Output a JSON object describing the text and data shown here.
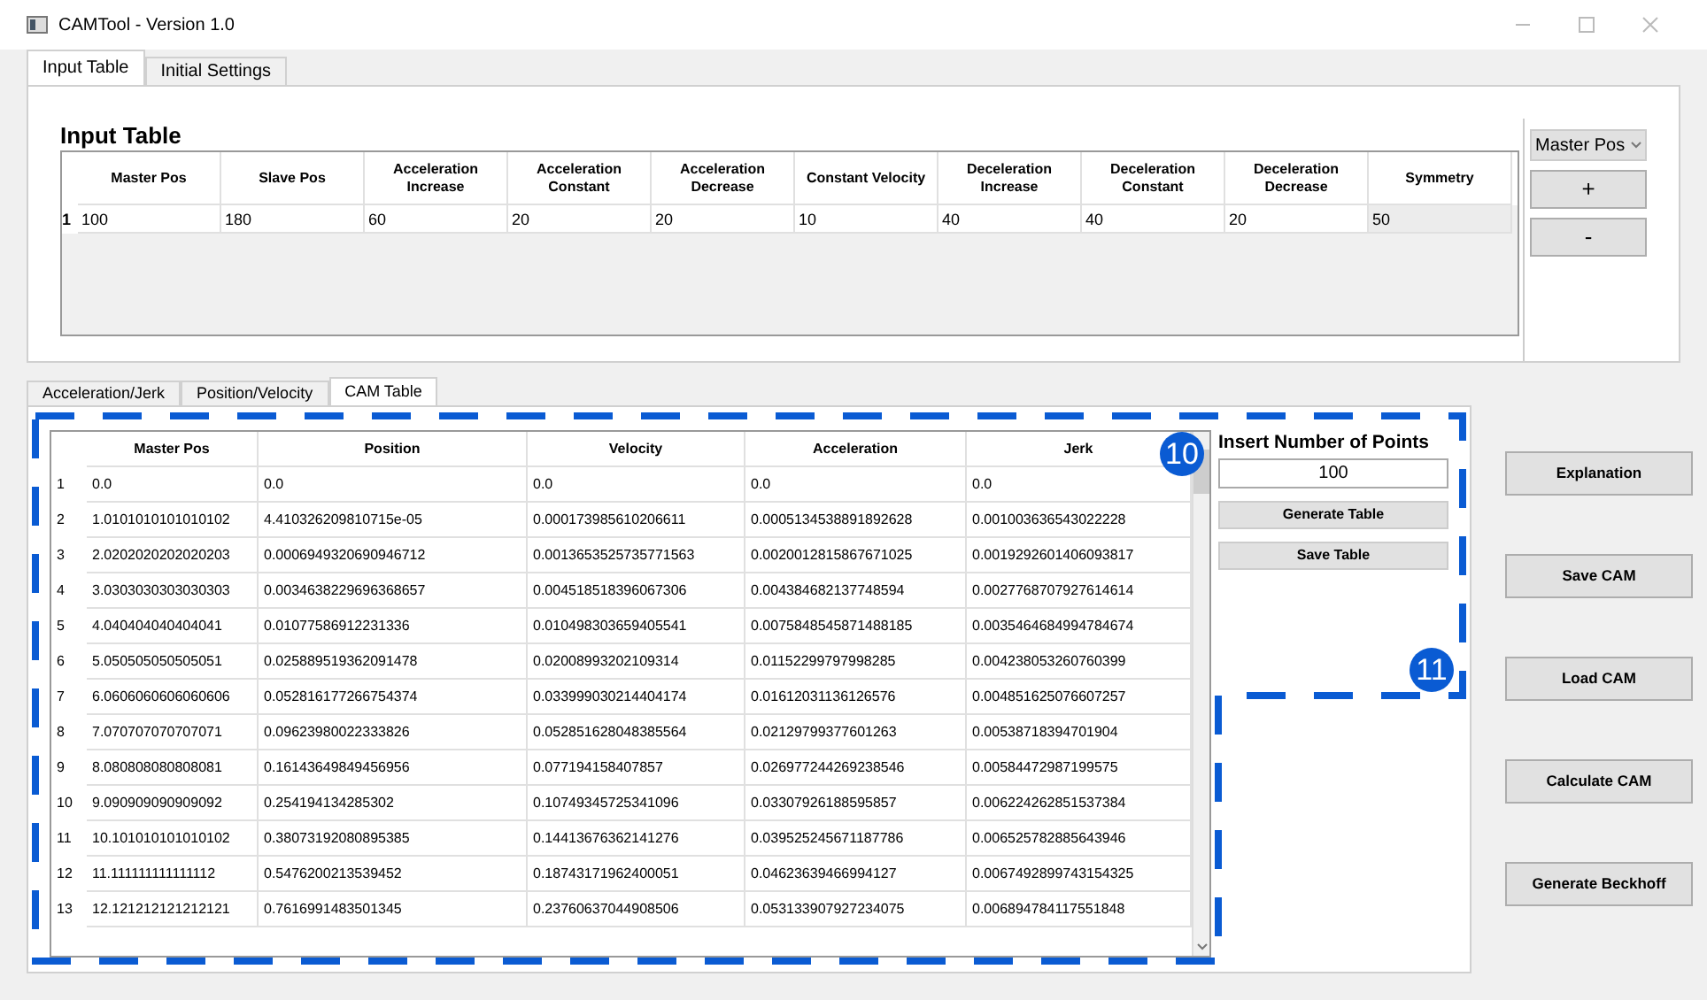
{
  "window": {
    "title": "CAMTool - Version 1.0"
  },
  "tabs": [
    {
      "label": "Input Table",
      "selected": true
    },
    {
      "label": "Initial Settings",
      "selected": false
    }
  ],
  "input_table": {
    "title": "Input Table",
    "columns": [
      "Master Pos",
      "Slave Pos",
      "Acceleration Increase",
      "Acceleration Constant",
      "Acceleration Decrease",
      "Constant Velocity",
      "Deceleration Increase",
      "Deceleration Constant",
      "Deceleration Decrease",
      "Symmetry"
    ],
    "rows": [
      {
        "index": "1",
        "cells": [
          "100",
          "180",
          "60",
          "20",
          "20",
          "10",
          "40",
          "40",
          "20",
          "50"
        ]
      }
    ]
  },
  "key_dropdown": {
    "value": "Master Pos"
  },
  "row_buttons": [
    "+",
    "-"
  ],
  "lower_tabs": [
    {
      "label": "Acceleration/Jerk",
      "selected": false
    },
    {
      "label": "Position/Velocity",
      "selected": false
    },
    {
      "label": "CAM Table",
      "selected": true
    }
  ],
  "cam_table": {
    "columns": [
      "Master Pos",
      "Position",
      "Velocity",
      "Acceleration",
      "Jerk"
    ],
    "rows": [
      {
        "index": "1",
        "cells": [
          "0.0",
          "0.0",
          "0.0",
          "0.0",
          "0.0"
        ]
      },
      {
        "index": "2",
        "cells": [
          "1.0101010101010102",
          "4.410326209810715e-05",
          "0.000173985610206611",
          "0.0005134538891892628",
          "0.001003636543022228"
        ]
      },
      {
        "index": "3",
        "cells": [
          "2.0202020202020203",
          "0.0006949320690946712",
          "0.0013653525735771563",
          "0.0020012815867671025",
          "0.0019292601406093817"
        ]
      },
      {
        "index": "4",
        "cells": [
          "3.0303030303030303",
          "0.0034638229696368657",
          "0.004518518396067306",
          "0.004384682137748594",
          "0.0027768707927614614"
        ]
      },
      {
        "index": "5",
        "cells": [
          "4.040404040404041",
          "0.01077586912231336",
          "0.010498303659405541",
          "0.0075848545871488185",
          "0.0035464684994784674"
        ]
      },
      {
        "index": "6",
        "cells": [
          "5.050505050505051",
          "0.025889519362091478",
          "0.02008993202109314",
          "0.01152299797998285",
          "0.004238053260760399"
        ]
      },
      {
        "index": "7",
        "cells": [
          "6.0606060606060606",
          "0.052816177266754374",
          "0.033999030214404174",
          "0.01612031136126576",
          "0.004851625076607257"
        ]
      },
      {
        "index": "8",
        "cells": [
          "7.070707070707071",
          "0.09623980022333826",
          "0.052851628048385564",
          "0.02129799377601263",
          "0.00538718394701904"
        ]
      },
      {
        "index": "9",
        "cells": [
          "8.080808080808081",
          "0.16143649849456956",
          "0.077194158407857",
          "0.026977244269238546",
          "0.00584472987199575"
        ]
      },
      {
        "index": "10",
        "cells": [
          "9.090909090909092",
          "0.254194134285302",
          "0.10749345725341096",
          "0.03307926188595857",
          "0.006224262851537384"
        ]
      },
      {
        "index": "11",
        "cells": [
          "10.101010101010102",
          "0.38073192080895385",
          "0.14413676362141276",
          "0.039525245671187786",
          "0.006525782885643946"
        ]
      },
      {
        "index": "12",
        "cells": [
          "11.111111111111112",
          "0.5476200213539452",
          "0.18743171962400051",
          "0.04623639466994127",
          "0.0067492899743154325"
        ]
      },
      {
        "index": "13",
        "cells": [
          "12.121212121212121",
          "0.7616991483501345",
          "0.23760637044908506",
          "0.053133907927234075",
          "0.006894784117551848"
        ]
      }
    ]
  },
  "points_panel": {
    "label": "Insert Number of Points",
    "value": "100",
    "buttons": [
      "Generate Table",
      "Save Table"
    ]
  },
  "side_buttons": [
    "Explanation",
    "Save CAM",
    "Load CAM",
    "Calculate CAM",
    "Generate Beckhoff"
  ],
  "annotations": [
    {
      "label": "10"
    },
    {
      "label": "11"
    }
  ]
}
